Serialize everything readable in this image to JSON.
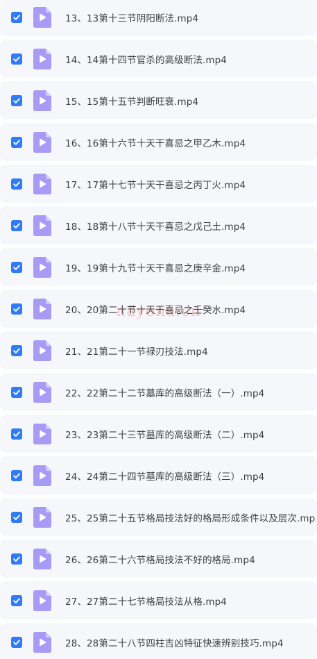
{
  "files": [
    {
      "name": "13、13第十三节阴阳断法.mp4",
      "checked": true,
      "icon": "video-file-icon"
    },
    {
      "name": "14、14第十四节官杀的高级断法.mp4",
      "checked": true,
      "icon": "video-file-icon"
    },
    {
      "name": "15、15第十五节判断旺衰.mp4",
      "checked": true,
      "icon": "video-file-icon"
    },
    {
      "name": "16、16第十六节十天干喜忌之甲乙木.mp4",
      "checked": true,
      "icon": "video-file-icon"
    },
    {
      "name": "17、17第十七节十天干喜忌之丙丁火.mp4",
      "checked": true,
      "icon": "video-file-icon"
    },
    {
      "name": "18、18第十八节十天干喜忌之戊己土.mp4",
      "checked": true,
      "icon": "video-file-icon"
    },
    {
      "name": "19、19第十九节十天干喜忌之庚辛金.mp4",
      "checked": true,
      "icon": "video-file-icon"
    },
    {
      "name": "20、20第二十节十天干喜忌之壬癸水.mp4",
      "checked": true,
      "icon": "video-file-icon"
    },
    {
      "name": "21、21第二十一节禄刃技法.mp4",
      "checked": true,
      "icon": "video-file-icon"
    },
    {
      "name": "22、22第二十二节墓库的高级断法（一）.mp4",
      "checked": true,
      "icon": "video-file-icon"
    },
    {
      "name": "23、23第二十三节墓库的高级断法（二）.mp4",
      "checked": true,
      "icon": "video-file-icon"
    },
    {
      "name": "24、24第二十四节墓库的高级断法（三）.mp4",
      "checked": true,
      "icon": "video-file-icon"
    },
    {
      "name": "25、25第二十五节格局技法好的格局形成条件以及层次.mp",
      "checked": true,
      "icon": "video-file-icon"
    },
    {
      "name": "26、26第二十六节格局技法不好的格局.mp4",
      "checked": true,
      "icon": "video-file-icon"
    },
    {
      "name": "27、27第二十七节格局技法从格.mp4",
      "checked": true,
      "icon": "video-file-icon"
    },
    {
      "name": "28、28第二十八节四柱吉凶特征快速辨别技巧.mp4",
      "checked": true,
      "icon": "video-file-icon"
    }
  ],
  "watermark": "nayona.cn",
  "colors": {
    "checkbox": "#2f7cf6",
    "file_icon_body": "#a99bf5",
    "file_icon_fold": "#d3cafb",
    "row_background": "#f6f7fa"
  }
}
